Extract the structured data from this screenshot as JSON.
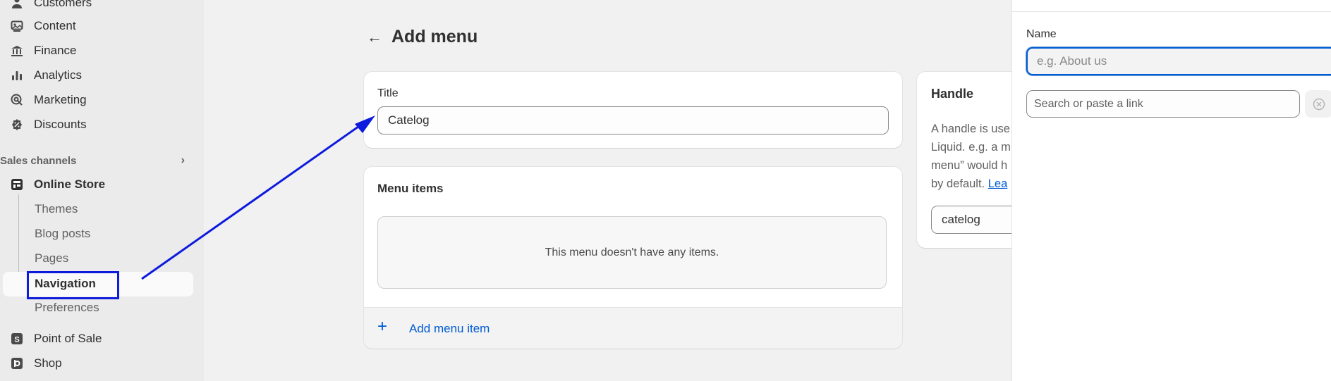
{
  "sidebar": {
    "items": [
      {
        "label": "Customers",
        "icon": "person-icon"
      },
      {
        "label": "Content",
        "icon": "image-icon"
      },
      {
        "label": "Finance",
        "icon": "bank-icon"
      },
      {
        "label": "Analytics",
        "icon": "bar-chart-icon"
      },
      {
        "label": "Marketing",
        "icon": "target-icon"
      },
      {
        "label": "Discounts",
        "icon": "discount-icon"
      }
    ],
    "sales_channels_label": "Sales channels",
    "online_store": "Online Store",
    "sub_items": [
      "Themes",
      "Blog posts",
      "Pages",
      "Navigation",
      "Preferences"
    ],
    "point_of_sale": "Point of Sale",
    "shop": "Shop"
  },
  "main": {
    "back_icon": "arrow-left-icon",
    "title": "Add menu",
    "title_card": {
      "label": "Title",
      "value": "Catelog"
    },
    "menu_items": {
      "heading": "Menu items",
      "empty_text": "This menu doesn't have any items.",
      "add_label": "Add menu item"
    },
    "handle": {
      "heading": "Handle",
      "line1": "A handle is use",
      "line2": "Liquid. e.g. a m",
      "line3": "menu” would h",
      "line4": "by default. ",
      "learn_link": "Lea",
      "value": "catelog"
    }
  },
  "panel": {
    "name_label": "Name",
    "name_placeholder": "e.g. About us",
    "link_placeholder": "Search or paste a link"
  },
  "colors": {
    "accent": "#005bd3",
    "annotation": "#0d1bdc"
  }
}
